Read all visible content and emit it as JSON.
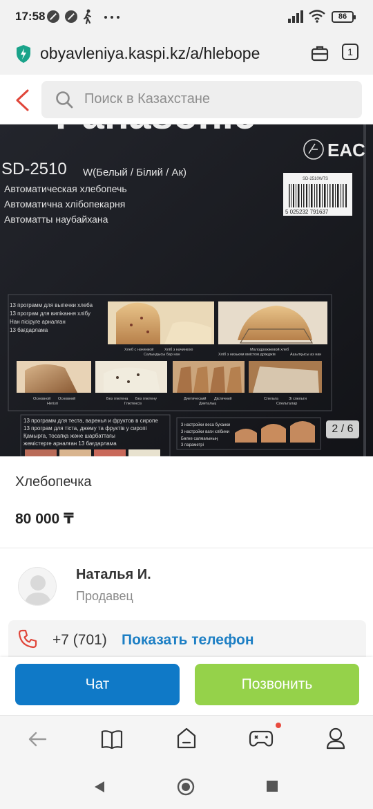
{
  "status_bar": {
    "time": "17:58",
    "battery": "86"
  },
  "browser": {
    "url": "obyavleniya.kaspi.kz/a/hlebope",
    "tab_count": "1"
  },
  "search": {
    "placeholder": "Поиск в Казахстане"
  },
  "gallery": {
    "counter": "2 / 6",
    "box_text": {
      "brand": "Panasonic",
      "model": "SD-2510",
      "variant": "W(Белый / Білий / Ак)",
      "lines": [
        "Автоматическая хлебопечь",
        "Автоматична хлібопекарня",
        "Автоматты наубайхана"
      ],
      "barcode_label": "SD-2510WTS",
      "barcode_number": "5 025232 791637",
      "eac": "EAC",
      "programs_bread": [
        "13 программ для выпечки хлеба",
        "13 програм для випікання хлібу",
        "Нан пісіруге арналған",
        "13 бағдарлама"
      ],
      "programs_jam": [
        "13 программ для теста, варенья и фруктов в сиропе",
        "13 програм для тіста, джему та фруктів у сиропі",
        "Қамырға, тосапқа және шарбаттағы",
        "жемістерге арналған 13 бағдарлама"
      ],
      "settings": [
        "3 настройки веса буханки",
        "3 настройки ваги хлібини",
        "Бөлке салмағының",
        "3 параметрі"
      ],
      "captions": [
        "Хлеб с начинкой",
        "Хліб з начинкою",
        "Салындысы бар нан",
        "Малодрожжевой хлеб",
        "Хліб з низьким вмістом дріжджів",
        "Ашытқысы аз нан",
        "Основной",
        "Основний",
        "Негізгі",
        "Без глютена",
        "Без глютену",
        "Глютенсіз",
        "Диетический",
        "Дієтичний",
        "Диеталық",
        "Спельта",
        "Зі спельти",
        "Спельталар"
      ]
    }
  },
  "product": {
    "title": "Хлебопечка",
    "price": "80 000 ₸"
  },
  "seller": {
    "name": "Наталья И.",
    "role": "Продавец"
  },
  "phone": {
    "number": "+7 (701)",
    "show_label": "Показать телефон"
  },
  "actions": {
    "chat_label": "Чат",
    "call_label": "Позвонить"
  },
  "colors": {
    "chat_button": "#0f79c7",
    "call_button": "#95d24a",
    "link_blue": "#1d7fc4",
    "back_arrow": "#e0463a",
    "phone_icon": "#e0463a",
    "notification_dot": "#e84a3e",
    "secure_icon": "#1aa38a"
  },
  "icons": {
    "secure": "shield-icon",
    "tabs_switcher": "briefcase-icon",
    "search": "search-icon",
    "back": "chevron-left-icon",
    "phone": "phone-icon",
    "nav": [
      "back-arrow-icon",
      "book-icon",
      "home-icon",
      "gamepad-icon",
      "profile-icon"
    ]
  }
}
